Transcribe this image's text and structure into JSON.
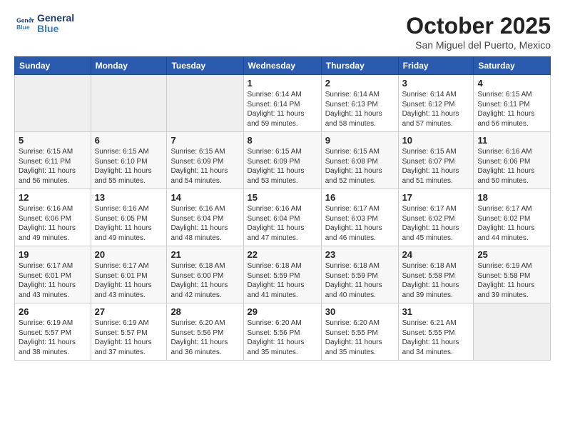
{
  "header": {
    "logo_line1": "General",
    "logo_line2": "Blue",
    "month_title": "October 2025",
    "location": "San Miguel del Puerto, Mexico"
  },
  "weekdays": [
    "Sunday",
    "Monday",
    "Tuesday",
    "Wednesday",
    "Thursday",
    "Friday",
    "Saturday"
  ],
  "weeks": [
    [
      {
        "day": "",
        "info": ""
      },
      {
        "day": "",
        "info": ""
      },
      {
        "day": "",
        "info": ""
      },
      {
        "day": "1",
        "info": "Sunrise: 6:14 AM\nSunset: 6:14 PM\nDaylight: 11 hours\nand 59 minutes."
      },
      {
        "day": "2",
        "info": "Sunrise: 6:14 AM\nSunset: 6:13 PM\nDaylight: 11 hours\nand 58 minutes."
      },
      {
        "day": "3",
        "info": "Sunrise: 6:14 AM\nSunset: 6:12 PM\nDaylight: 11 hours\nand 57 minutes."
      },
      {
        "day": "4",
        "info": "Sunrise: 6:15 AM\nSunset: 6:11 PM\nDaylight: 11 hours\nand 56 minutes."
      }
    ],
    [
      {
        "day": "5",
        "info": "Sunrise: 6:15 AM\nSunset: 6:11 PM\nDaylight: 11 hours\nand 56 minutes."
      },
      {
        "day": "6",
        "info": "Sunrise: 6:15 AM\nSunset: 6:10 PM\nDaylight: 11 hours\nand 55 minutes."
      },
      {
        "day": "7",
        "info": "Sunrise: 6:15 AM\nSunset: 6:09 PM\nDaylight: 11 hours\nand 54 minutes."
      },
      {
        "day": "8",
        "info": "Sunrise: 6:15 AM\nSunset: 6:09 PM\nDaylight: 11 hours\nand 53 minutes."
      },
      {
        "day": "9",
        "info": "Sunrise: 6:15 AM\nSunset: 6:08 PM\nDaylight: 11 hours\nand 52 minutes."
      },
      {
        "day": "10",
        "info": "Sunrise: 6:15 AM\nSunset: 6:07 PM\nDaylight: 11 hours\nand 51 minutes."
      },
      {
        "day": "11",
        "info": "Sunrise: 6:16 AM\nSunset: 6:06 PM\nDaylight: 11 hours\nand 50 minutes."
      }
    ],
    [
      {
        "day": "12",
        "info": "Sunrise: 6:16 AM\nSunset: 6:06 PM\nDaylight: 11 hours\nand 49 minutes."
      },
      {
        "day": "13",
        "info": "Sunrise: 6:16 AM\nSunset: 6:05 PM\nDaylight: 11 hours\nand 49 minutes."
      },
      {
        "day": "14",
        "info": "Sunrise: 6:16 AM\nSunset: 6:04 PM\nDaylight: 11 hours\nand 48 minutes."
      },
      {
        "day": "15",
        "info": "Sunrise: 6:16 AM\nSunset: 6:04 PM\nDaylight: 11 hours\nand 47 minutes."
      },
      {
        "day": "16",
        "info": "Sunrise: 6:17 AM\nSunset: 6:03 PM\nDaylight: 11 hours\nand 46 minutes."
      },
      {
        "day": "17",
        "info": "Sunrise: 6:17 AM\nSunset: 6:02 PM\nDaylight: 11 hours\nand 45 minutes."
      },
      {
        "day": "18",
        "info": "Sunrise: 6:17 AM\nSunset: 6:02 PM\nDaylight: 11 hours\nand 44 minutes."
      }
    ],
    [
      {
        "day": "19",
        "info": "Sunrise: 6:17 AM\nSunset: 6:01 PM\nDaylight: 11 hours\nand 43 minutes."
      },
      {
        "day": "20",
        "info": "Sunrise: 6:17 AM\nSunset: 6:01 PM\nDaylight: 11 hours\nand 43 minutes."
      },
      {
        "day": "21",
        "info": "Sunrise: 6:18 AM\nSunset: 6:00 PM\nDaylight: 11 hours\nand 42 minutes."
      },
      {
        "day": "22",
        "info": "Sunrise: 6:18 AM\nSunset: 5:59 PM\nDaylight: 11 hours\nand 41 minutes."
      },
      {
        "day": "23",
        "info": "Sunrise: 6:18 AM\nSunset: 5:59 PM\nDaylight: 11 hours\nand 40 minutes."
      },
      {
        "day": "24",
        "info": "Sunrise: 6:18 AM\nSunset: 5:58 PM\nDaylight: 11 hours\nand 39 minutes."
      },
      {
        "day": "25",
        "info": "Sunrise: 6:19 AM\nSunset: 5:58 PM\nDaylight: 11 hours\nand 39 minutes."
      }
    ],
    [
      {
        "day": "26",
        "info": "Sunrise: 6:19 AM\nSunset: 5:57 PM\nDaylight: 11 hours\nand 38 minutes."
      },
      {
        "day": "27",
        "info": "Sunrise: 6:19 AM\nSunset: 5:57 PM\nDaylight: 11 hours\nand 37 minutes."
      },
      {
        "day": "28",
        "info": "Sunrise: 6:20 AM\nSunset: 5:56 PM\nDaylight: 11 hours\nand 36 minutes."
      },
      {
        "day": "29",
        "info": "Sunrise: 6:20 AM\nSunset: 5:56 PM\nDaylight: 11 hours\nand 35 minutes."
      },
      {
        "day": "30",
        "info": "Sunrise: 6:20 AM\nSunset: 5:55 PM\nDaylight: 11 hours\nand 35 minutes."
      },
      {
        "day": "31",
        "info": "Sunrise: 6:21 AM\nSunset: 5:55 PM\nDaylight: 11 hours\nand 34 minutes."
      },
      {
        "day": "",
        "info": ""
      }
    ]
  ]
}
